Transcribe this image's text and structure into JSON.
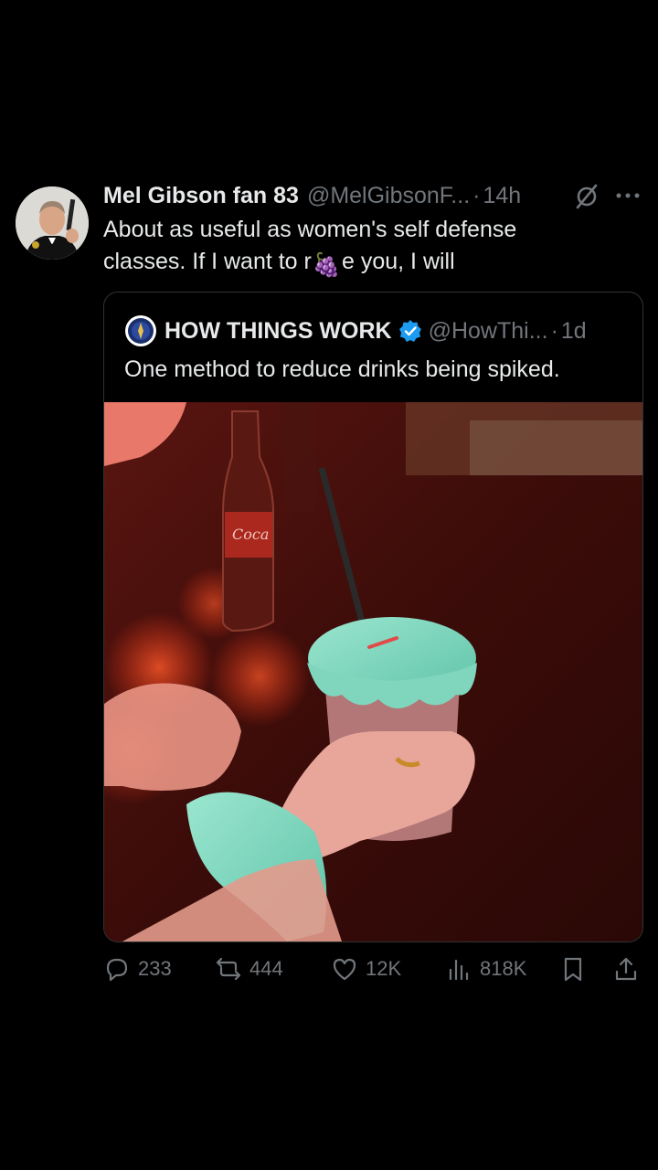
{
  "tweet": {
    "display_name": "Mel Gibson fan 83",
    "handle": "@MelGibsonF...",
    "separator": "·",
    "time": "14h",
    "text_line1": "About as useful as women's self defense",
    "text_line2_before": "classes. If I want to r",
    "text_emoji": "🍇",
    "text_line2_after": "e you, I will"
  },
  "quote": {
    "display_name": "HOW THINGS WORK",
    "handle": "@HowThi...",
    "separator": "·",
    "time": "1d",
    "text": "One method to reduce drinks being spiked."
  },
  "actions": {
    "replies": "233",
    "reposts": "444",
    "likes": "12K",
    "views": "818K"
  },
  "icons": {
    "reply": "reply-icon",
    "repost": "repost-icon",
    "like": "heart-icon",
    "views": "views-chart-icon",
    "bookmark": "bookmark-icon",
    "share": "share-icon",
    "grok": "grok-icon",
    "more": "more-icon",
    "mute": "mute-icon"
  },
  "colors": {
    "background": "#000000",
    "text": "#e7e9ea",
    "muted": "#71767b",
    "verified": "#1d9bf0"
  }
}
